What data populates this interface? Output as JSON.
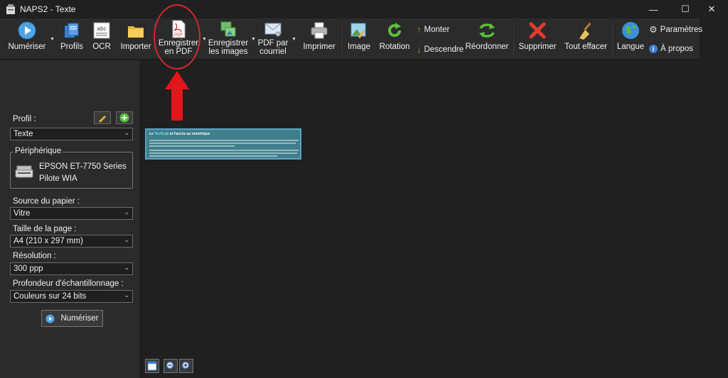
{
  "window": {
    "title": "NAPS2 - Texte",
    "minimize": "—",
    "maximize": "☐",
    "close": "✕"
  },
  "toolbar": {
    "scan": "Numériser",
    "profiles": "Profils",
    "ocr": "OCR",
    "import": "Importer",
    "save_pdf_line1": "Enregistrer",
    "save_pdf_line2": "en PDF",
    "save_images_line1": "Enregistrer",
    "save_images_line2": "les images",
    "email_pdf_line1": "PDF par",
    "email_pdf_line2": "courriel",
    "print": "Imprimer",
    "image": "Image",
    "rotation": "Rotation",
    "move_up": "Monter",
    "move_down": "Descendre",
    "reorder": "Réordonner",
    "delete": "Supprimer",
    "clear_all": "Tout effacer",
    "language": "Langue",
    "settings": "Paramètres",
    "about": "À propos",
    "pdf_icon_text": "PDF",
    "abc_icon_text": "abc"
  },
  "left_panel": {
    "profile_label": "Profil :",
    "profile_value": "Texte",
    "device_group": "Périphérique",
    "device_name": "EPSON ET-7750 Series",
    "device_driver": "Pilote WIA",
    "paper_source_label": "Source du papier :",
    "paper_source_value": "Vitre",
    "page_size_label": "Taille de la page :",
    "page_size_value": "A4 (210 x 297 mm)",
    "resolution_label": "Résolution :",
    "resolution_value": "300 ppp",
    "bit_depth_label": "Profondeur d'échantillonnage :",
    "bit_depth_value": "Couleurs sur 24 bits",
    "scan_button": "Numériser"
  },
  "thumbnail": {
    "title_prefix": "Le ",
    "title_brand": "TechLab",
    "title_suffix": " et l'accès au numérique"
  },
  "colors": {
    "annotation": "#d8262d",
    "thumbnail_bg": "#3e7f8b",
    "accent": "#5aa3c8"
  }
}
